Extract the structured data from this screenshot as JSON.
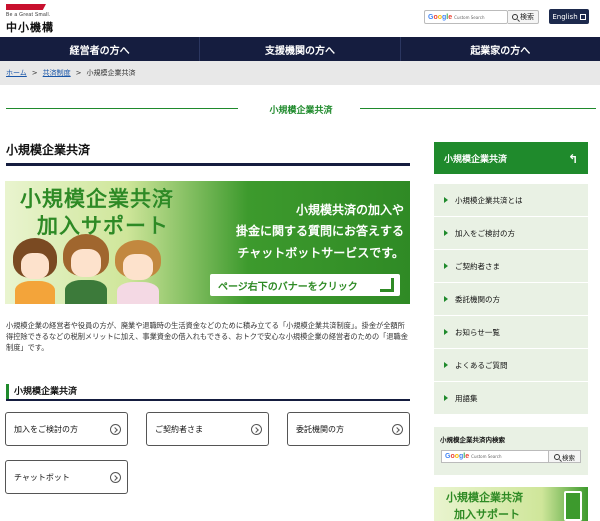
{
  "header": {
    "logo_tagline": "Be a Great Small.",
    "logo_name": "中小機構",
    "search_placeholder": "Custom Search",
    "search_button": "検索",
    "english_button": "English"
  },
  "nav": {
    "items": [
      {
        "label": "経営者の方へ"
      },
      {
        "label": "支援機関の方へ"
      },
      {
        "label": "起業家の方へ"
      }
    ]
  },
  "breadcrumb": {
    "home": "ホーム",
    "sep": ">",
    "parent": "共済制度",
    "current": "小規模企業共済"
  },
  "band_title": "小規模企業共済",
  "page_title": "小規模企業共済",
  "banner": {
    "title_line1": "小規模企業共済",
    "title_line2": "加入サポート",
    "text_line1": "小規模共済の加入や",
    "text_line2": "掛金に関する質問にお答えする",
    "text_line3": "チャットボットサービスです。",
    "button_label": "ページ右下のバナーをクリック"
  },
  "description": "小規模企業の経営者や役員の方が、廃業や退職時の生活資金などのために積み立てる「小規模企業共済制度」。掛金が全額所得控除できるなどの税制メリットに加え、事業資金の借入れもできる、おトクで安心な小規模企業の経営者のための「退職金制度」です。",
  "section": {
    "heading": "小規模企業共済",
    "buttons": [
      {
        "label": "加入をご検討の方"
      },
      {
        "label": "ご契約者さま"
      },
      {
        "label": "委託機関の方"
      },
      {
        "label": "チャットボット"
      }
    ]
  },
  "sidebar": {
    "head": "小規模企業共済",
    "back_icon": "↰",
    "items": [
      {
        "label": "小規模企業共済とは"
      },
      {
        "label": "加入をご検討の方"
      },
      {
        "label": "ご契約者さま"
      },
      {
        "label": "委託機関の方"
      },
      {
        "label": "お知らせ一覧"
      },
      {
        "label": "よくあるご質問"
      },
      {
        "label": "用語集"
      }
    ],
    "search_title": "小規模企業共済内検索",
    "search_placeholder": "Custom Search",
    "search_button": "検索",
    "banner_line1": "小規模企業共済",
    "banner_line2": "加入サポート"
  },
  "colors": {
    "navy": "#151d3f",
    "green": "#1f8a2c",
    "logo_red": "#c8102e"
  }
}
